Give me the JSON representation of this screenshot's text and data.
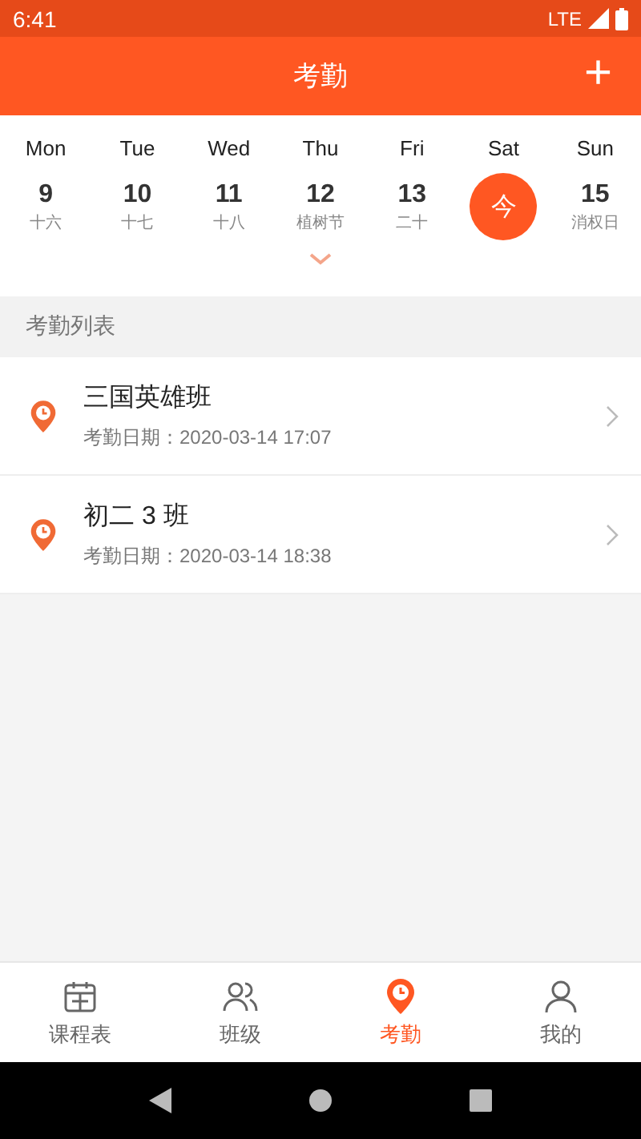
{
  "status_bar": {
    "time": "6:41",
    "network": "LTE"
  },
  "header": {
    "title": "考勤",
    "action": "+"
  },
  "calendar": {
    "days": [
      {
        "weekday": "Mon",
        "date": "9",
        "lunar": "十六",
        "selected": false
      },
      {
        "weekday": "Tue",
        "date": "10",
        "lunar": "十七",
        "selected": false
      },
      {
        "weekday": "Wed",
        "date": "11",
        "lunar": "十八",
        "selected": false
      },
      {
        "weekday": "Thu",
        "date": "12",
        "lunar": "植树节",
        "selected": false
      },
      {
        "weekday": "Fri",
        "date": "13",
        "lunar": "二十",
        "selected": false
      },
      {
        "weekday": "Sat",
        "date": "今",
        "selected": true
      },
      {
        "weekday": "Sun",
        "date": "15",
        "lunar": "消权日",
        "selected": false
      }
    ]
  },
  "section_title": "考勤列表",
  "records": [
    {
      "name": "三国英雄班",
      "date": "考勤日期：2020-03-14 17:07"
    },
    {
      "name": "初二 3 班",
      "date": "考勤日期：2020-03-14 18:38"
    }
  ],
  "tabs": [
    {
      "label": "课程表",
      "kind": "calendar",
      "selected": false
    },
    {
      "label": "班级",
      "kind": "group",
      "selected": false
    },
    {
      "label": "考勤",
      "kind": "pin",
      "selected": true
    },
    {
      "label": "我的",
      "kind": "person",
      "selected": false
    }
  ]
}
